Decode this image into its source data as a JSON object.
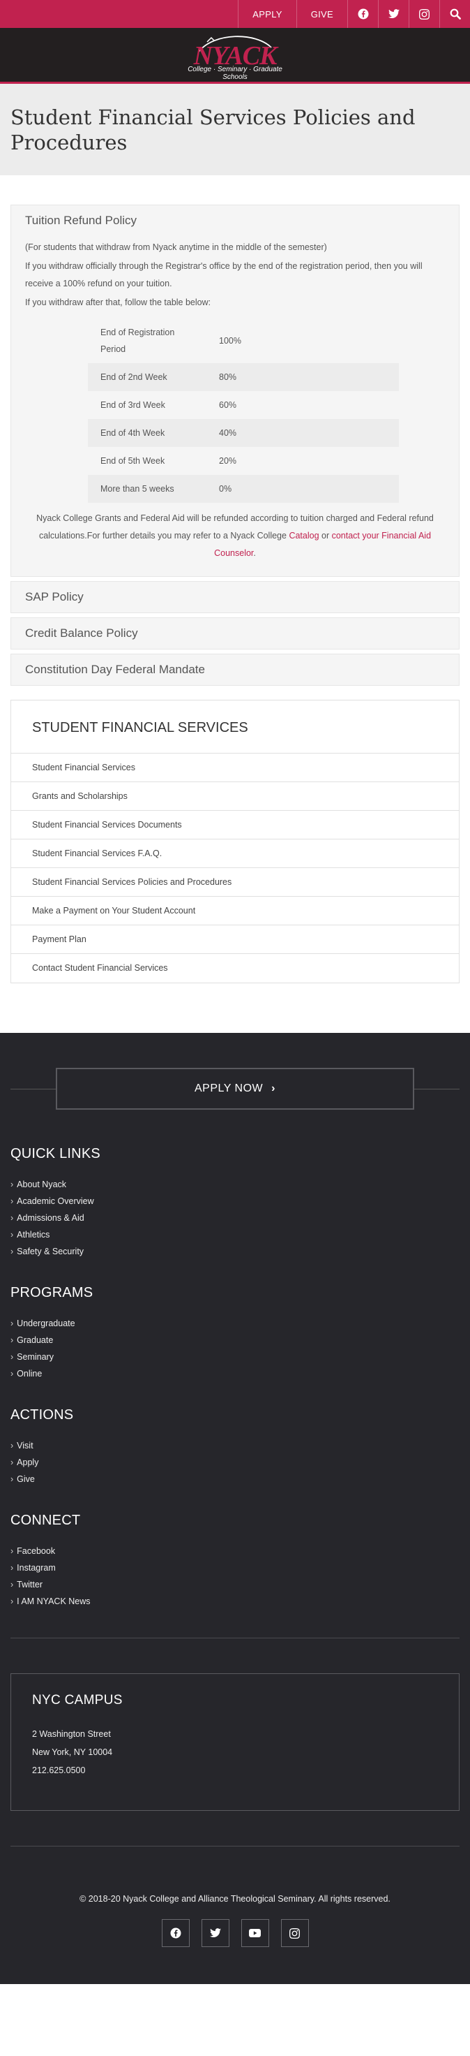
{
  "topbar": {
    "apply": "APPLY",
    "give": "GIVE",
    "icons": [
      "facebook-icon",
      "twitter-icon",
      "instagram-icon",
      "search-icon"
    ]
  },
  "logo": {
    "name": "NYACK",
    "tagline": "College · Seminary · Graduate Schools"
  },
  "page": {
    "title": "Student Financial Services Policies and Procedures"
  },
  "accordion": [
    {
      "title": "Tuition Refund Policy",
      "expanded": true
    },
    {
      "title": "SAP Policy",
      "expanded": false
    },
    {
      "title": "Credit Balance Policy",
      "expanded": false
    },
    {
      "title": "Constitution Day Federal Mandate",
      "expanded": false
    }
  ],
  "refund": {
    "intro": "(For students that withdraw from Nyack anytime in the middle of the semester)",
    "p1": "If you withdraw officially through the Registrar's office by the end of the registration period, then you will receive a 100% refund on your tuition.",
    "p2": "If you withdraw after that, follow the table below:",
    "rows": [
      {
        "period": "End of Registration Period",
        "refund": "100%"
      },
      {
        "period": "End of 2nd Week",
        "refund": "80%"
      },
      {
        "period": "End of 3rd Week",
        "refund": "60%"
      },
      {
        "period": "End of 4th Week",
        "refund": "40%"
      },
      {
        "period": "End of 5th Week",
        "refund": "20%"
      },
      {
        "period": "More than 5 weeks",
        "refund": "0%"
      }
    ],
    "note_pre": "Nyack College Grants and Federal Aid will be refunded according to tuition charged and Federal refund calculations.For further details you may refer to a Nyack College ",
    "note_link1": "Catalog",
    "note_mid": " or ",
    "note_link2": "contact your Financial Aid Counselor",
    "note_end": "."
  },
  "sfs": {
    "title": "STUDENT FINANCIAL SERVICES",
    "items": [
      "Student Financial Services",
      "Grants and Scholarships",
      "Student Financial Services Documents",
      "Student Financial Services F.A.Q.",
      "Student Financial Services Policies and Procedures",
      "Make a Payment on Your Student Account",
      "Payment Plan",
      "Contact Student Financial Services"
    ]
  },
  "footer": {
    "apply_now": "APPLY NOW",
    "quick_links": {
      "title": "QUICK LINKS",
      "items": [
        "About Nyack",
        "Academic Overview",
        "Admissions & Aid",
        "Athletics",
        "Safety & Security"
      ]
    },
    "programs": {
      "title": "PROGRAMS",
      "items": [
        "Undergraduate",
        "Graduate",
        "Seminary",
        "Online"
      ]
    },
    "actions": {
      "title": "ACTIONS",
      "items": [
        "Visit",
        "Apply",
        "Give"
      ]
    },
    "connect": {
      "title": "CONNECT",
      "items": [
        "Facebook",
        "Instagram",
        "Twitter",
        "I AM NYACK News"
      ]
    },
    "campus": {
      "title": "NYC CAMPUS",
      "street": "2 Washington Street",
      "city": "New York, NY 10004",
      "phone": "212.625.0500"
    },
    "copyright": "© 2018-20 Nyack College and Alliance Theological Seminary. All rights reserved.",
    "social_icons": [
      "facebook-icon",
      "twitter-icon",
      "youtube-icon",
      "instagram-icon"
    ]
  },
  "colors": {
    "brand": "#c1224f",
    "header_dark": "#231f20",
    "footer_dark": "#26262b"
  }
}
